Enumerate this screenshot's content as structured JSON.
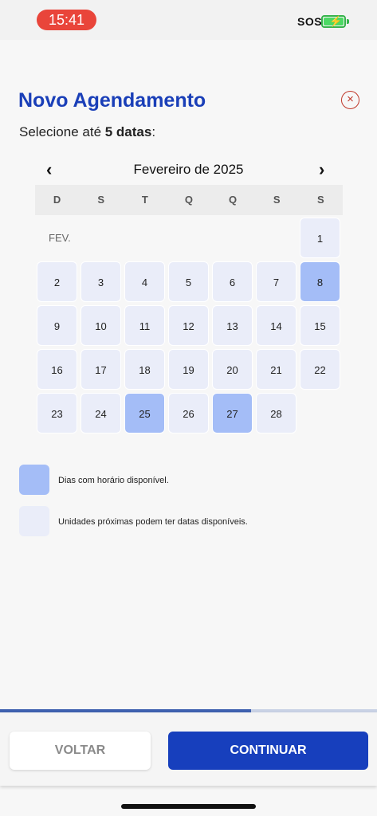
{
  "status": {
    "time": "15:41",
    "sos": "SOS"
  },
  "header": {
    "title": "Novo Agendamento",
    "close_icon": "×"
  },
  "subtitle": {
    "prefix": "Selecione até ",
    "bold": "5 datas",
    "suffix": ":"
  },
  "calendar": {
    "prev": "‹",
    "next": "›",
    "month": "Fevereiro de 2025",
    "weekdays": [
      "D",
      "S",
      "T",
      "Q",
      "Q",
      "S",
      "S"
    ],
    "month_abbr": "FEV.",
    "days": [
      "1",
      "2",
      "3",
      "4",
      "5",
      "6",
      "7",
      "8",
      "9",
      "10",
      "11",
      "12",
      "13",
      "14",
      "15",
      "16",
      "17",
      "18",
      "19",
      "20",
      "21",
      "22",
      "23",
      "24",
      "25",
      "26",
      "27",
      "28"
    ],
    "available_days": [
      "8",
      "25",
      "27"
    ]
  },
  "legend": {
    "available": "Dias com horário disponível.",
    "nearby": "Unidades próximas podem ter datas disponíveis.",
    "available_color": "#a4bdf7",
    "nearby_color": "#eaedf9"
  },
  "progress": {
    "value": 0.667
  },
  "footer": {
    "back_label": "VOLTAR",
    "continue_label": "CONTINUAR"
  }
}
